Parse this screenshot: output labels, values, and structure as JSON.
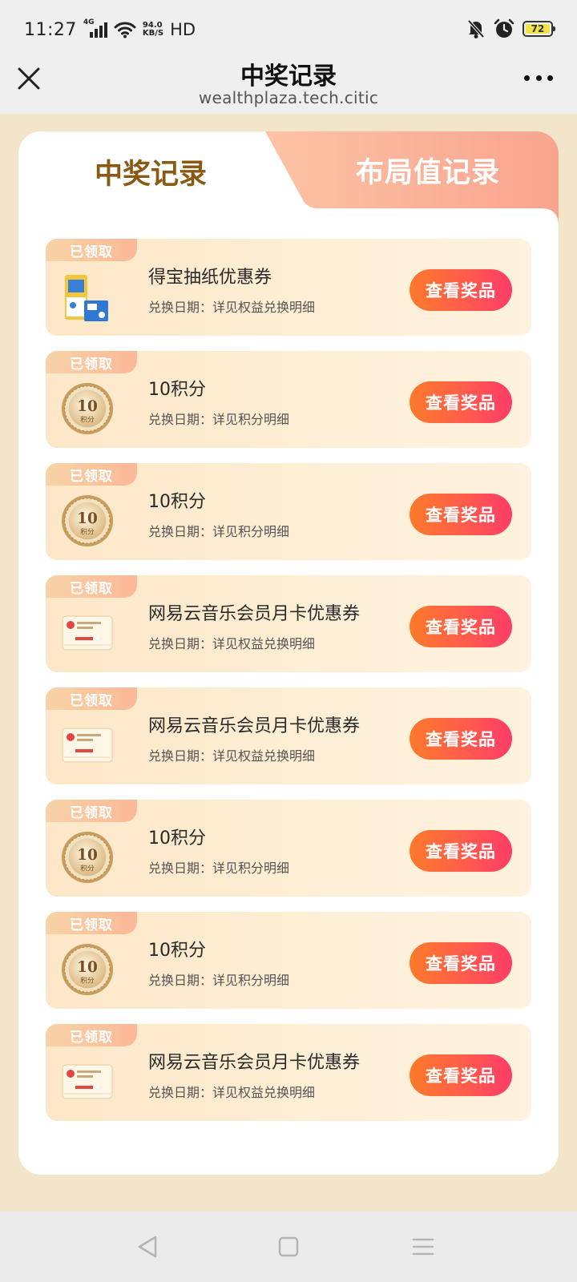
{
  "status_bar": {
    "time": "11:27",
    "network": "4G",
    "speed_value": "94.0",
    "speed_unit": "KB/S",
    "hd": "HD",
    "battery": "72"
  },
  "header": {
    "title": "中奖记录",
    "url": "wealthplaza.tech.citic"
  },
  "tabs": {
    "active": "中奖记录",
    "inactive": "布局值记录"
  },
  "records": [
    {
      "badge": "已领取",
      "title": "得宝抽纸优惠券",
      "subtitle": "兑换日期：详见权益兑换明细",
      "button": "查看奖品",
      "thumb": "tissue-pack"
    },
    {
      "badge": "已领取",
      "title": "10积分",
      "subtitle": "兑换日期：详见积分明细",
      "button": "查看奖品",
      "thumb": "points-coin",
      "coin_value": "10",
      "coin_label": "积分"
    },
    {
      "badge": "已领取",
      "title": "10积分",
      "subtitle": "兑换日期：详见积分明细",
      "button": "查看奖品",
      "thumb": "points-coin",
      "coin_value": "10",
      "coin_label": "积分"
    },
    {
      "badge": "已领取",
      "title": "网易云音乐会员月卡优惠券",
      "subtitle": "兑换日期：详见权益兑换明细",
      "button": "查看奖品",
      "thumb": "coupon-card"
    },
    {
      "badge": "已领取",
      "title": "网易云音乐会员月卡优惠券",
      "subtitle": "兑换日期：详见权益兑换明细",
      "button": "查看奖品",
      "thumb": "coupon-card"
    },
    {
      "badge": "已领取",
      "title": "10积分",
      "subtitle": "兑换日期：详见积分明细",
      "button": "查看奖品",
      "thumb": "points-coin",
      "coin_value": "10",
      "coin_label": "积分"
    },
    {
      "badge": "已领取",
      "title": "10积分",
      "subtitle": "兑换日期：详见积分明细",
      "button": "查看奖品",
      "thumb": "points-coin",
      "coin_value": "10",
      "coin_label": "积分"
    },
    {
      "badge": "已领取",
      "title": "网易云音乐会员月卡优惠券",
      "subtitle": "兑换日期：详见权益兑换明细",
      "button": "查看奖品",
      "thumb": "coupon-card"
    }
  ],
  "colors": {
    "page_bg": "#f3e5ca",
    "tab_active_text": "#8a5a14",
    "tab_inactive_bg": "#f8a88d",
    "button_start": "#fd7a2a",
    "button_end": "#ff3c68"
  },
  "nav_bar": {
    "icons": [
      "back-triangle-icon",
      "home-square-icon",
      "menu-lines-icon"
    ]
  }
}
